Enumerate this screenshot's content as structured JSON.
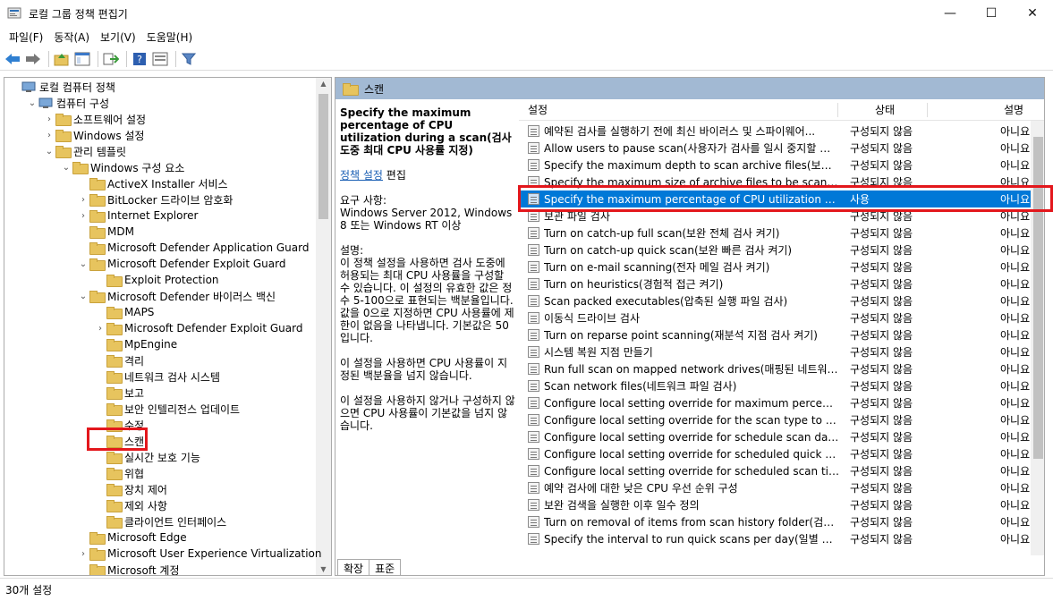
{
  "window": {
    "title": "로컬 그룹 정책 편집기",
    "min": "—",
    "max": "☐",
    "close": "✕"
  },
  "menu": [
    "파일(F)",
    "동작(A)",
    "보기(V)",
    "도움말(H)"
  ],
  "toolbar": {
    "icons": [
      "back-icon",
      "forward-icon",
      "up-folder-icon",
      "show-hide-tree-icon",
      "export-list-icon",
      "help-icon",
      "properties-icon",
      "filter-icon"
    ]
  },
  "tree": {
    "items": [
      {
        "label": "로컬 컴퓨터 정책",
        "level": 0,
        "chev": "",
        "icon": "computer"
      },
      {
        "label": "컴퓨터 구성",
        "level": 1,
        "chev": "⌄",
        "icon": "computer"
      },
      {
        "label": "소프트웨어 설정",
        "level": 2,
        "chev": "›",
        "icon": "folder"
      },
      {
        "label": "Windows 설정",
        "level": 2,
        "chev": "›",
        "icon": "folder"
      },
      {
        "label": "관리 템플릿",
        "level": 2,
        "chev": "⌄",
        "icon": "folder"
      },
      {
        "label": "Windows 구성 요소",
        "level": 3,
        "chev": "⌄",
        "icon": "folder"
      },
      {
        "label": "ActiveX Installer 서비스",
        "level": 4,
        "chev": "",
        "icon": "folder"
      },
      {
        "label": "BitLocker 드라이브 암호화",
        "level": 4,
        "chev": "›",
        "icon": "folder"
      },
      {
        "label": "Internet Explorer",
        "level": 4,
        "chev": "›",
        "icon": "folder"
      },
      {
        "label": "MDM",
        "level": 4,
        "chev": "",
        "icon": "folder"
      },
      {
        "label": "Microsoft Defender Application Guard",
        "level": 4,
        "chev": "",
        "icon": "folder"
      },
      {
        "label": "Microsoft Defender Exploit Guard",
        "level": 4,
        "chev": "⌄",
        "icon": "folder"
      },
      {
        "label": "Exploit Protection",
        "level": 5,
        "chev": "",
        "icon": "folder"
      },
      {
        "label": "Microsoft Defender 바이러스 백신",
        "level": 4,
        "chev": "⌄",
        "icon": "folder"
      },
      {
        "label": "MAPS",
        "level": 5,
        "chev": "",
        "icon": "folder"
      },
      {
        "label": "Microsoft Defender Exploit Guard",
        "level": 5,
        "chev": "›",
        "icon": "folder"
      },
      {
        "label": "MpEngine",
        "level": 5,
        "chev": "",
        "icon": "folder"
      },
      {
        "label": "격리",
        "level": 5,
        "chev": "",
        "icon": "folder"
      },
      {
        "label": "네트워크 검사 시스템",
        "level": 5,
        "chev": "",
        "icon": "folder"
      },
      {
        "label": "보고",
        "level": 5,
        "chev": "",
        "icon": "folder"
      },
      {
        "label": "보안 인텔리전스 업데이트",
        "level": 5,
        "chev": "",
        "icon": "folder"
      },
      {
        "label": "수정",
        "level": 5,
        "chev": "",
        "icon": "folder"
      },
      {
        "label": "스캔",
        "level": 5,
        "chev": "",
        "icon": "folder"
      },
      {
        "label": "실시간 보호 기능",
        "level": 5,
        "chev": "",
        "icon": "folder"
      },
      {
        "label": "위협",
        "level": 5,
        "chev": "",
        "icon": "folder"
      },
      {
        "label": "장치 제어",
        "level": 5,
        "chev": "",
        "icon": "folder"
      },
      {
        "label": "제외 사항",
        "level": 5,
        "chev": "",
        "icon": "folder"
      },
      {
        "label": "클라이언트 인터페이스",
        "level": 5,
        "chev": "",
        "icon": "folder"
      },
      {
        "label": "Microsoft Edge",
        "level": 4,
        "chev": "",
        "icon": "folder"
      },
      {
        "label": "Microsoft User Experience Virtualization",
        "level": 4,
        "chev": "›",
        "icon": "folder"
      },
      {
        "label": "Microsoft 계정",
        "level": 4,
        "chev": "",
        "icon": "folder"
      }
    ],
    "selected_index": 22
  },
  "right": {
    "header": "스캔",
    "desc": {
      "title": "Specify the maximum percentage of CPU utilization during a scan(검사 도중 최대 CPU 사용률 지정)",
      "link": "정책 설정",
      "link_suffix": " 편집",
      "req_label": "요구 사항:",
      "req_text": "Windows Server 2012, Windows 8 또는 Windows RT 이상",
      "desc_label": "설명:",
      "desc_text1": "이 정책 설정을 사용하면 검사 도중에 허용되는 최대 CPU 사용률을 구성할 수 있습니다. 이 설정의 유효한 값은 정수 5-100으로 표현되는 백분율입니다. 값을 0으로 지정하면 CPU 사용률에 제한이 없음을 나타냅니다. 기본값은 50입니다.",
      "desc_text2": "이 설정을 사용하면 CPU 사용률이 지정된 백분율을 넘지 않습니다.",
      "desc_text3": "이 설정을 사용하지 않거나 구성하지 않으면 CPU 사용률이 기본값을 넘지 않습니다."
    },
    "columns": {
      "name": "설정",
      "state": "상태",
      "comment": "설명"
    },
    "rows": [
      {
        "name": "예약된 검사를 실행하기 전에 최신 바이러스 및 스파이웨어...",
        "state": "구성되지 않음",
        "comment": "아니요"
      },
      {
        "name": "Allow users to pause scan(사용자가 검사를 일시 중지할 수...",
        "state": "구성되지 않음",
        "comment": "아니요"
      },
      {
        "name": "Specify the maximum depth to scan archive files(보관 파...",
        "state": "구성되지 않음",
        "comment": "아니요"
      },
      {
        "name": "Specify the maximum size of archive files to be scanned(...",
        "state": "구성되지 않음",
        "comment": "아니요"
      },
      {
        "name": "Specify the maximum percentage of CPU utilization durin...",
        "state": "사용",
        "comment": "아니요"
      },
      {
        "name": "보관 파일 검사",
        "state": "구성되지 않음",
        "comment": "아니요"
      },
      {
        "name": "Turn on catch-up full scan(보완 전체 검사 켜기)",
        "state": "구성되지 않음",
        "comment": "아니요"
      },
      {
        "name": "Turn on catch-up quick scan(보완 빠른 검사 켜기)",
        "state": "구성되지 않음",
        "comment": "아니요"
      },
      {
        "name": "Turn on e-mail scanning(전자 메일 검사 켜기)",
        "state": "구성되지 않음",
        "comment": "아니요"
      },
      {
        "name": "Turn on heuristics(경험적 접근 켜기)",
        "state": "구성되지 않음",
        "comment": "아니요"
      },
      {
        "name": "Scan packed executables(압축된 실행 파일 검사)",
        "state": "구성되지 않음",
        "comment": "아니요"
      },
      {
        "name": "이동식 드라이브 검사",
        "state": "구성되지 않음",
        "comment": "아니요"
      },
      {
        "name": "Turn on reparse point scanning(재분석 지점 검사 켜기)",
        "state": "구성되지 않음",
        "comment": "아니요"
      },
      {
        "name": "시스템 복원 지점 만들기",
        "state": "구성되지 않음",
        "comment": "아니요"
      },
      {
        "name": "Run full scan on mapped network drives(매핑된 네트워크 ...",
        "state": "구성되지 않음",
        "comment": "아니요"
      },
      {
        "name": "Scan network files(네트워크 파일 검사)",
        "state": "구성되지 않음",
        "comment": "아니요"
      },
      {
        "name": "Configure local setting override for maximum percentage ...",
        "state": "구성되지 않음",
        "comment": "아니요"
      },
      {
        "name": "Configure local setting override for the scan type to use fo...",
        "state": "구성되지 않음",
        "comment": "아니요"
      },
      {
        "name": "Configure local setting override for schedule scan day(예...",
        "state": "구성되지 않음",
        "comment": "아니요"
      },
      {
        "name": "Configure local setting override for scheduled quick scan t...",
        "state": "구성되지 않음",
        "comment": "아니요"
      },
      {
        "name": "Configure local setting override for scheduled scan time(...",
        "state": "구성되지 않음",
        "comment": "아니요"
      },
      {
        "name": "예약 검사에 대한 낮은 CPU 우선 순위 구성",
        "state": "구성되지 않음",
        "comment": "아니요"
      },
      {
        "name": "보완 검색을 실행한 이후 일수 정의",
        "state": "구성되지 않음",
        "comment": "아니요"
      },
      {
        "name": "Turn on removal of items from scan history folder(검사 기...",
        "state": "구성되지 않음",
        "comment": "아니요"
      },
      {
        "name": "Specify the interval to run quick scans per day(일별 빠른 ...",
        "state": "구성되지 않음",
        "comment": "아니요"
      }
    ],
    "selected_row": 4,
    "tabs": [
      "확장",
      "표준"
    ]
  },
  "status": "30개 설정"
}
